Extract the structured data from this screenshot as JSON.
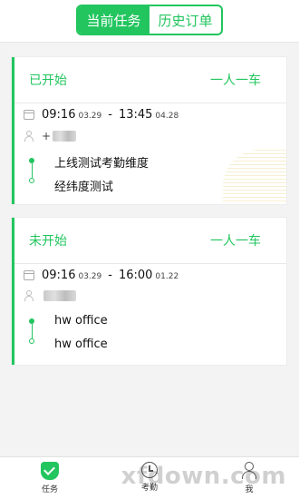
{
  "header": {
    "tabs": [
      {
        "label": "当前任务",
        "active": true
      },
      {
        "label": "历史订单",
        "active": false
      }
    ]
  },
  "orders": [
    {
      "status": "已开始",
      "mode": "一人一车",
      "start_time": "09:16",
      "start_date": "03.29",
      "separator": "-",
      "end_time": "13:45",
      "end_date": "04.28",
      "passenger_prefix": "+",
      "from": "上线测试考勤维度",
      "to": "经纬度测试"
    },
    {
      "status": "未开始",
      "mode": "一人一车",
      "start_time": "09:16",
      "start_date": "03.29",
      "separator": "-",
      "end_time": "16:00",
      "end_date": "01.22",
      "passenger_prefix": "",
      "from": "hw office",
      "to": "hw office"
    }
  ],
  "tabbar": {
    "items": [
      {
        "label": "任务",
        "icon": "task-icon",
        "active": true
      },
      {
        "label": "考勤",
        "icon": "clock-icon",
        "active": false
      },
      {
        "label": "我",
        "icon": "user-icon",
        "active": false
      }
    ]
  },
  "watermark": "xfdown.com",
  "colors": {
    "accent": "#22c55e",
    "background": "#f3f3f3"
  }
}
